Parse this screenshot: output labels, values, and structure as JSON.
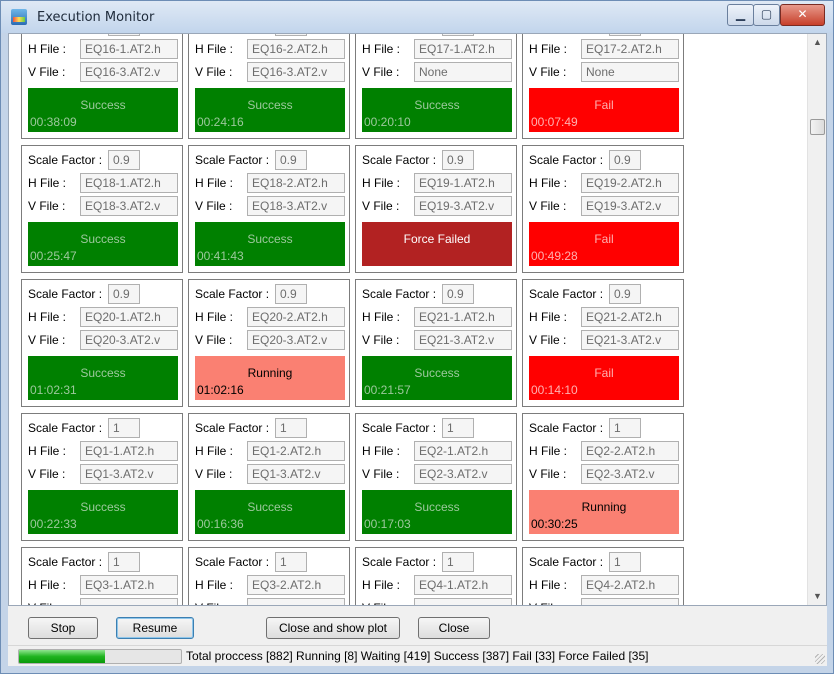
{
  "window": {
    "title": "Execution Monitor",
    "minimize_icon": "minimize-icon",
    "maximize_icon": "maximize-icon",
    "close_icon": "close-icon"
  },
  "labels": {
    "scale_factor": "Scale Factor :",
    "h_file": "H File :",
    "v_file": "V File :"
  },
  "panels": [
    {
      "scale": "",
      "h": "EQ16-1.AT2.h",
      "v": "EQ16-3.AT2.v",
      "status": "Success",
      "time": "00:38:09",
      "kind": "success"
    },
    {
      "scale": "",
      "h": "EQ16-2.AT2.h",
      "v": "EQ16-3.AT2.v",
      "status": "Success",
      "time": "00:24:16",
      "kind": "success"
    },
    {
      "scale": "",
      "h": "EQ17-1.AT2.h",
      "v": "None",
      "status": "Success",
      "time": "00:20:10",
      "kind": "success"
    },
    {
      "scale": "",
      "h": "EQ17-2.AT2.h",
      "v": "None",
      "status": "Fail",
      "time": "00:07:49",
      "kind": "fail"
    },
    {
      "scale": "0.9",
      "h": "EQ18-1.AT2.h",
      "v": "EQ18-3.AT2.v",
      "status": "Success",
      "time": "00:25:47",
      "kind": "success"
    },
    {
      "scale": "0.9",
      "h": "EQ18-2.AT2.h",
      "v": "EQ18-3.AT2.v",
      "status": "Success",
      "time": "00:41:43",
      "kind": "success"
    },
    {
      "scale": "0.9",
      "h": "EQ19-1.AT2.h",
      "v": "EQ19-3.AT2.v",
      "status": "Force Failed",
      "time": "",
      "kind": "force"
    },
    {
      "scale": "0.9",
      "h": "EQ19-2.AT2.h",
      "v": "EQ19-3.AT2.v",
      "status": "Fail",
      "time": "00:49:28",
      "kind": "fail"
    },
    {
      "scale": "0.9",
      "h": "EQ20-1.AT2.h",
      "v": "EQ20-3.AT2.v",
      "status": "Success",
      "time": "01:02:31",
      "kind": "success"
    },
    {
      "scale": "0.9",
      "h": "EQ20-2.AT2.h",
      "v": "EQ20-3.AT2.v",
      "status": "Running",
      "time": "01:02:16",
      "kind": "running"
    },
    {
      "scale": "0.9",
      "h": "EQ21-1.AT2.h",
      "v": "EQ21-3.AT2.v",
      "status": "Success",
      "time": "00:21:57",
      "kind": "success"
    },
    {
      "scale": "0.9",
      "h": "EQ21-2.AT2.h",
      "v": "EQ21-3.AT2.v",
      "status": "Fail",
      "time": "00:14:10",
      "kind": "fail"
    },
    {
      "scale": "1",
      "h": "EQ1-1.AT2.h",
      "v": "EQ1-3.AT2.v",
      "status": "Success",
      "time": "00:22:33",
      "kind": "success"
    },
    {
      "scale": "1",
      "h": "EQ1-2.AT2.h",
      "v": "EQ1-3.AT2.v",
      "status": "Success",
      "time": "00:16:36",
      "kind": "success"
    },
    {
      "scale": "1",
      "h": "EQ2-1.AT2.h",
      "v": "EQ2-3.AT2.v",
      "status": "Success",
      "time": "00:17:03",
      "kind": "success"
    },
    {
      "scale": "1",
      "h": "EQ2-2.AT2.h",
      "v": "EQ2-3.AT2.v",
      "status": "Running",
      "time": "00:30:25",
      "kind": "running"
    },
    {
      "scale": "1",
      "h": "EQ3-1.AT2.h",
      "v": "",
      "status": "",
      "time": "",
      "kind": ""
    },
    {
      "scale": "1",
      "h": "EQ3-2.AT2.h",
      "v": "",
      "status": "",
      "time": "",
      "kind": ""
    },
    {
      "scale": "1",
      "h": "EQ4-1.AT2.h",
      "v": "",
      "status": "",
      "time": "",
      "kind": ""
    },
    {
      "scale": "1",
      "h": "EQ4-2.AT2.h",
      "v": "",
      "status": "",
      "time": "",
      "kind": ""
    }
  ],
  "buttons": {
    "stop": "Stop",
    "resume": "Resume",
    "close_and_show_plot": "Close and show plot",
    "close": "Close"
  },
  "statusbar": {
    "progress_fraction": 0.53,
    "summary": "Total proccess [882] Running  [8]  Waiting [419]  Success  [387]  Fail  [33]  Force Failed [35]"
  },
  "colors": {
    "success": "#008000",
    "fail": "#ff0000",
    "running": "#fa8072",
    "force_failed": "#b22222"
  }
}
